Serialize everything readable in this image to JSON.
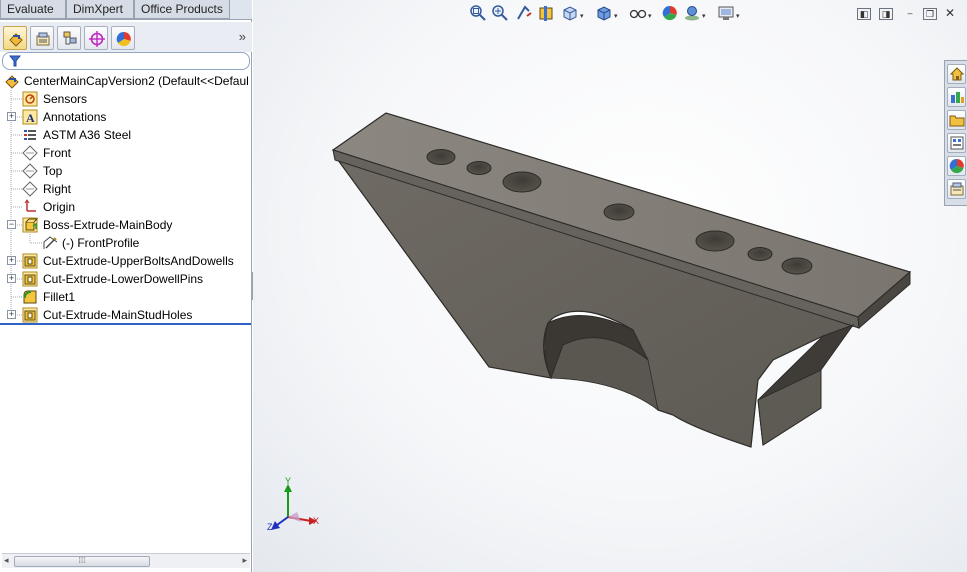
{
  "command_tabs": [
    "Evaluate",
    "DimXpert",
    "Office Products"
  ],
  "tree": {
    "root": "CenterMainCapVersion2  (Default<<Defaul",
    "items": [
      {
        "label": "Sensors",
        "icon": "sensors-icon"
      },
      {
        "label": "Annotations",
        "icon": "annotations-icon",
        "expandable": true
      },
      {
        "label": "ASTM A36 Steel",
        "icon": "material-icon"
      },
      {
        "label": "Front",
        "icon": "plane-icon"
      },
      {
        "label": "Top",
        "icon": "plane-icon"
      },
      {
        "label": "Right",
        "icon": "plane-icon"
      },
      {
        "label": "Origin",
        "icon": "origin-icon"
      },
      {
        "label": "Boss-Extrude-MainBody",
        "icon": "boss-extrude-icon",
        "expandable": true,
        "expanded": true
      },
      {
        "label": "(-) FrontProfile",
        "icon": "sketch-icon",
        "child": true
      },
      {
        "label": "Cut-Extrude-UpperBoltsAndDowells",
        "icon": "cut-extrude-icon",
        "expandable": true
      },
      {
        "label": "Cut-Extrude-LowerDowellPins",
        "icon": "cut-extrude-icon",
        "expandable": true
      },
      {
        "label": "Fillet1",
        "icon": "fillet-icon"
      },
      {
        "label": "Cut-Extrude-MainStudHoles",
        "icon": "cut-extrude-icon",
        "expandable": true
      }
    ]
  },
  "triad": {
    "x": "X",
    "y": "Y",
    "z": "Z"
  },
  "colors": {
    "accent": "#2f62c7",
    "part_face_top": "#7f7a73",
    "part_face_side": "#5e5a54"
  }
}
